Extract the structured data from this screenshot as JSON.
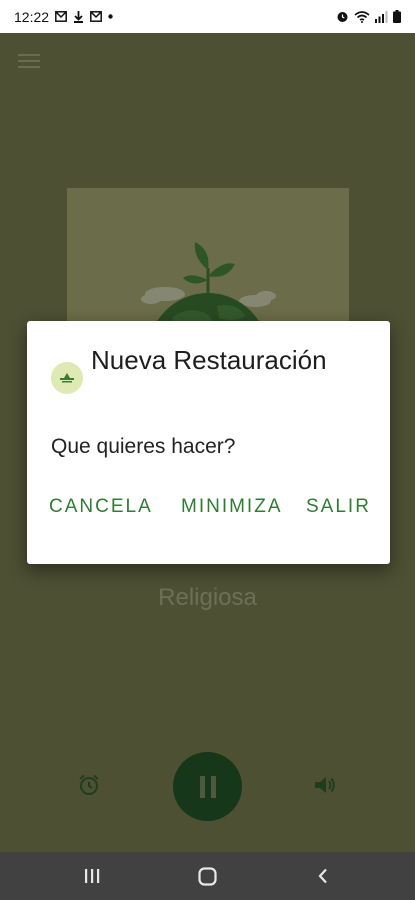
{
  "status_bar": {
    "time": "12:22"
  },
  "player": {
    "title": "Religiosa"
  },
  "dialog": {
    "title": "Nueva Restauración",
    "message": "Que quieres hacer?",
    "buttons": {
      "cancel": "CANCELA",
      "minimize": "MINIMIZA",
      "exit": "SALIR"
    }
  },
  "colors": {
    "background": "#4d5033",
    "accent_green": "#2e7d32",
    "pause_button": "#17371b",
    "dialog_bg": "#ffffff"
  },
  "icons": [
    "menu-icon",
    "alarm-icon",
    "pause-icon",
    "volume-icon",
    "recent-apps-icon",
    "home-icon",
    "back-icon"
  ]
}
